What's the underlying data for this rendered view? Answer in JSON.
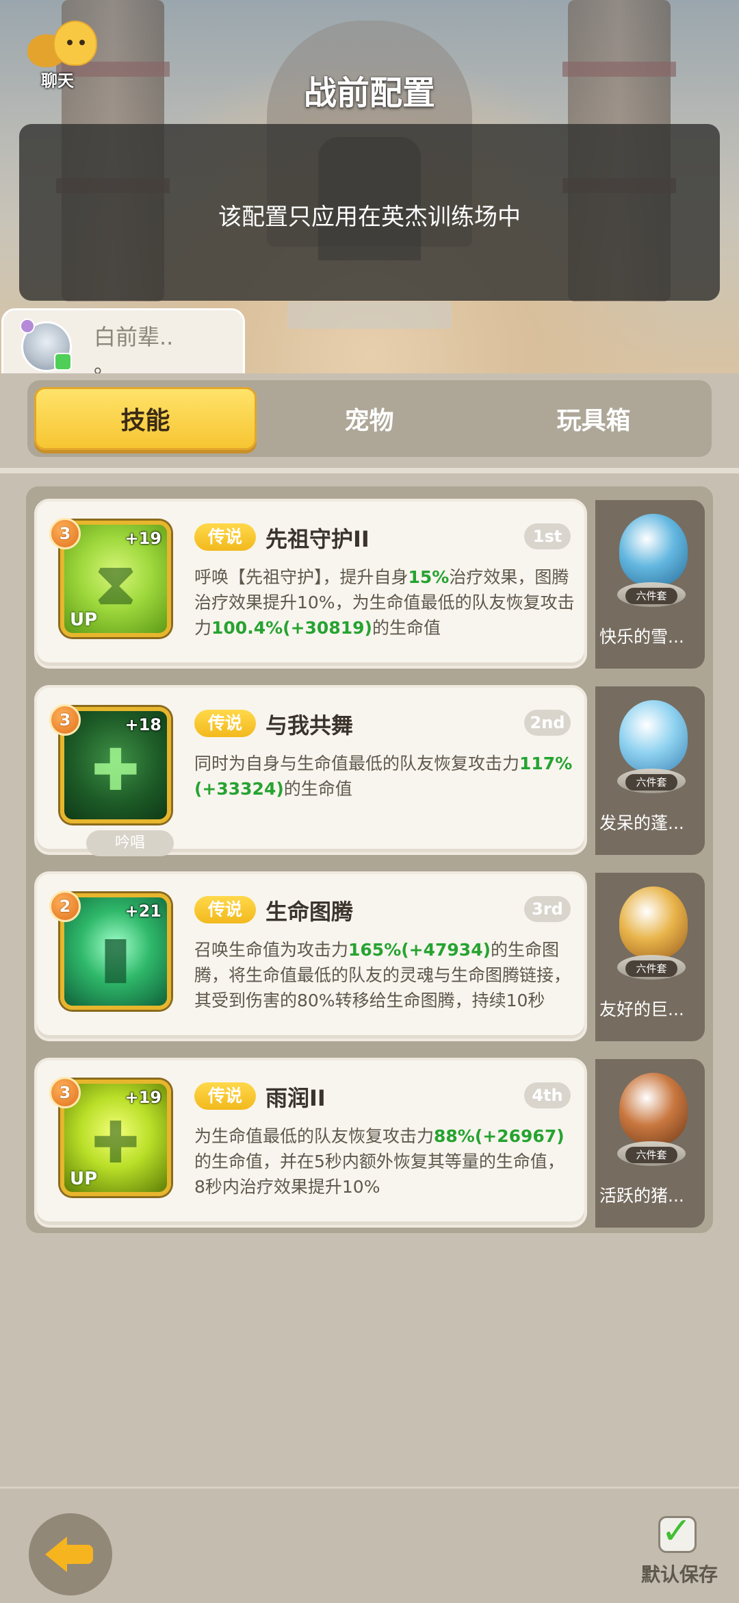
{
  "header": {
    "chat_label": "聊天",
    "title": "战前配置",
    "notice": "该配置只应用在英杰训练场中"
  },
  "profile": {
    "name": "白前辈..",
    "sub": "。"
  },
  "tabs": [
    {
      "label": "技能",
      "active": true
    },
    {
      "label": "宠物",
      "active": false
    },
    {
      "label": "玩具箱",
      "active": false
    }
  ],
  "skills": [
    {
      "star": "3",
      "bonus": "+19",
      "up_label": "UP",
      "rarity": "传说",
      "name": "先祖守护II",
      "rank": "1st",
      "desc_parts": [
        "呼唤【先祖守护】，提升自身",
        "15%",
        "治疗效果，图腾治疗效果提升10%，为生命值最低的队友恢复攻击力",
        "100.4%",
        "(+30819)",
        "的生命值"
      ],
      "pet": {
        "tag": "六件套",
        "name": "快乐的雪..."
      }
    },
    {
      "star": "3",
      "bonus": "+18",
      "chant": "吟唱",
      "rarity": "传说",
      "name": "与我共舞",
      "rank": "2nd",
      "desc_parts": [
        "同时为自身与生命值最低的队友恢复攻击力",
        "117%",
        "(+33324)",
        "的生命值"
      ],
      "pet": {
        "tag": "六件套",
        "name": "发呆的蓬..."
      }
    },
    {
      "star": "2",
      "bonus": "+21",
      "rarity": "传说",
      "name": "生命图腾",
      "rank": "3rd",
      "desc_parts": [
        "召唤生命值为攻击力",
        "165%",
        "(+47934)",
        "的生命图腾，将生命值最低的队友的灵魂与生命图腾链接，其受到伤害的80%转移给生命图腾，持续10秒"
      ],
      "pet": {
        "tag": "六件套",
        "name": "友好的巨..."
      }
    },
    {
      "star": "3",
      "bonus": "+19",
      "up_label": "UP",
      "rarity": "传说",
      "name": "雨润II",
      "rank": "4th",
      "desc_parts": [
        "为生命值最低的队友恢复攻击力",
        "88%",
        "(+26967)",
        "的生命值，并在5秒内额外恢复其等量的生命值，8秒内治疗效果提升10%"
      ],
      "pet": {
        "tag": "六件套",
        "name": "活跃的猪..."
      }
    }
  ],
  "footer": {
    "save_default_label": "默认保存",
    "save_default_checked": true
  },
  "colors": {
    "accent_gold": "#f6c532",
    "highlight_green": "#26a331",
    "panel_dark": "#766c60"
  },
  "icons": [
    "chat-icon",
    "back-arrow-icon",
    "checkbox-checked-icon"
  ]
}
